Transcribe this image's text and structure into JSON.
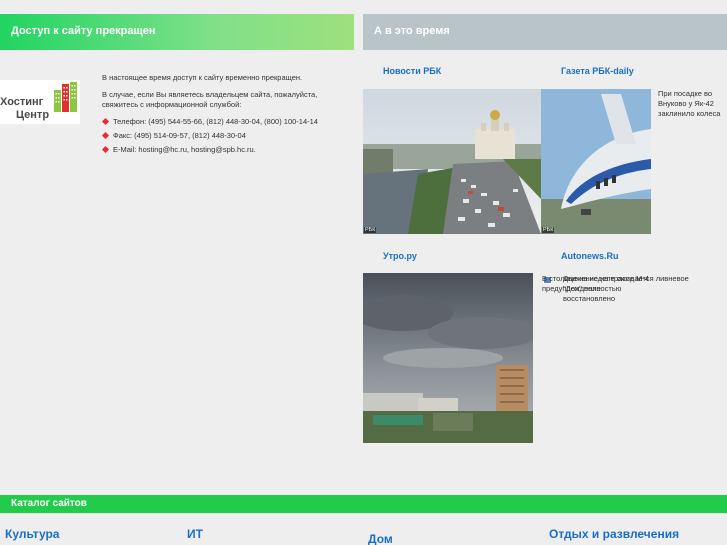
{
  "header": {
    "left_title": "Доступ к сайту прекращен",
    "right_title": "А в это время"
  },
  "logo": {
    "line1": "Хостинг",
    "line2": "Центр",
    "colors": {
      "bars": [
        "#8cc63f",
        "#e03030",
        "#8cc63f"
      ]
    }
  },
  "message": {
    "p1": "В настоящее время доступ к сайту временно прекращен.",
    "p2": "В случае, если Вы являетесь владельцем сайта, пожалуйста, свяжитесь с информационной службой:",
    "contacts": [
      "Телефон: (495) 544-55-66, (812) 448-30-04, (800) 100-14-14",
      "Факс: (495) 514-09-57, (812) 448-30-04",
      "E-Mail: hosting@hc.ru, hosting@spb.hc.ru."
    ]
  },
  "news": {
    "rbc": {
      "title": "Новости РБК",
      "tag": "РБК"
    },
    "rbc_daily": {
      "title": "Газета РБК-daily",
      "tag": "РБК",
      "text": "При посадке во Внуково у Як-42 заклинило колеса"
    },
    "utro": {
      "title": "Утро.ру"
    },
    "autonews": {
      "title": "Autonews.Ru",
      "text_a": "В столице на неделе ожидается ливневое предупреждение",
      "text_b": "Движение на трассе M-4 \"Дон\" полностью восстановлено"
    }
  },
  "catalog": {
    "label": "Каталог сайтов",
    "categories": [
      "Культура",
      "ИТ",
      "Дом",
      "Отдых и развлечения"
    ]
  },
  "colors": {
    "accent_green": "#22cc4a",
    "link_blue": "#1a6fc4",
    "header_gray": "#b8c4c8"
  }
}
